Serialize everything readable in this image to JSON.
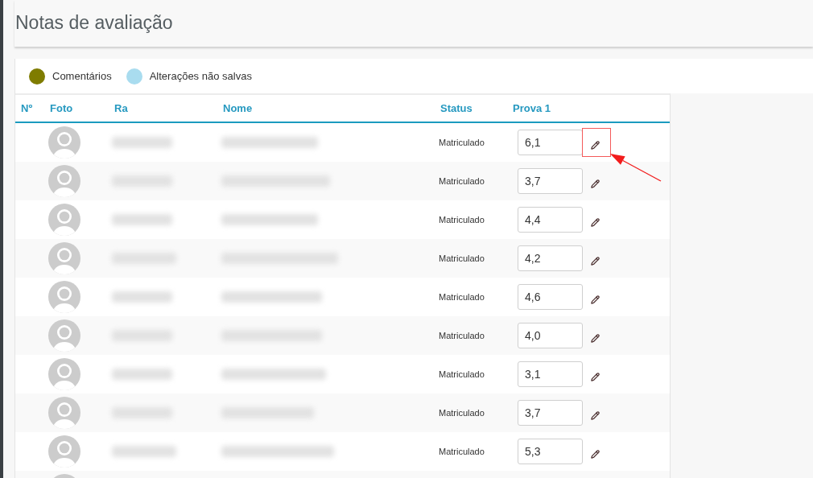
{
  "page": {
    "title": "Notas de avaliação"
  },
  "legend": [
    {
      "label": "Comentários",
      "color": "#7f7c00"
    },
    {
      "label": "Alterações não salvas",
      "color": "#a9dcef"
    }
  ],
  "table": {
    "columns": [
      "Nº",
      "Foto",
      "Ra",
      "Nome",
      "Status",
      "Prova 1"
    ],
    "rows": [
      {
        "kind": "student",
        "status": "Matriculado",
        "grade": "6,1",
        "highlighted": true
      },
      {
        "kind": "student",
        "status": "Matriculado",
        "grade": "3,7",
        "highlighted": false
      },
      {
        "kind": "student",
        "status": "Matriculado",
        "grade": "4,4",
        "highlighted": false
      },
      {
        "kind": "student",
        "status": "Matriculado",
        "grade": "4,2",
        "highlighted": false
      },
      {
        "kind": "student",
        "status": "Matriculado",
        "grade": "4,6",
        "highlighted": false
      },
      {
        "kind": "student",
        "status": "Matriculado",
        "grade": "4,0",
        "highlighted": false
      },
      {
        "kind": "student",
        "status": "Matriculado",
        "grade": "3,1",
        "highlighted": false
      },
      {
        "kind": "student",
        "status": "Matriculado",
        "grade": "3,7",
        "highlighted": false
      },
      {
        "kind": "student",
        "status": "Matriculado",
        "grade": "5,3",
        "highlighted": false
      },
      {
        "kind": "cut_off"
      }
    ]
  }
}
